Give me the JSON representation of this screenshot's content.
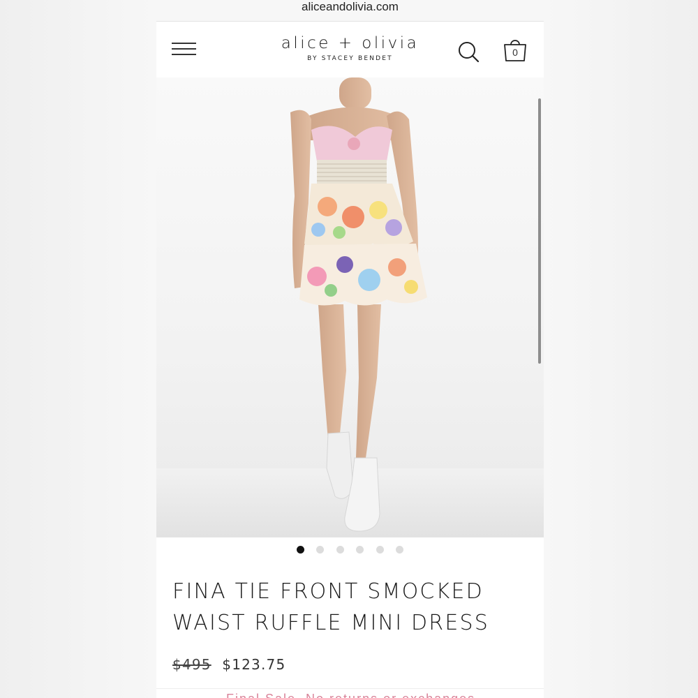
{
  "browser": {
    "url": "aliceandolivia.com"
  },
  "header": {
    "brand_name": "alice + olivia",
    "brand_subtitle": "BY STACEY BENDET",
    "menu_icon": "hamburger-menu-icon",
    "search_icon": "search-icon",
    "bag_icon": "shopping-bag-icon",
    "bag_count": "0"
  },
  "gallery": {
    "image_count": 6,
    "active_index": 0
  },
  "product": {
    "title_line1": "FINA TIE FRONT SMOCKED",
    "title_line2": "WAIST RUFFLE MINI DRESS",
    "original_price": "$495",
    "sale_price": "$123.75"
  },
  "banner": {
    "text": "Final Sale, No returns or exchanges"
  },
  "colors": {
    "banner_text": "#d9849a",
    "active_dot": "#111111",
    "inactive_dot": "#dcdcdc"
  }
}
